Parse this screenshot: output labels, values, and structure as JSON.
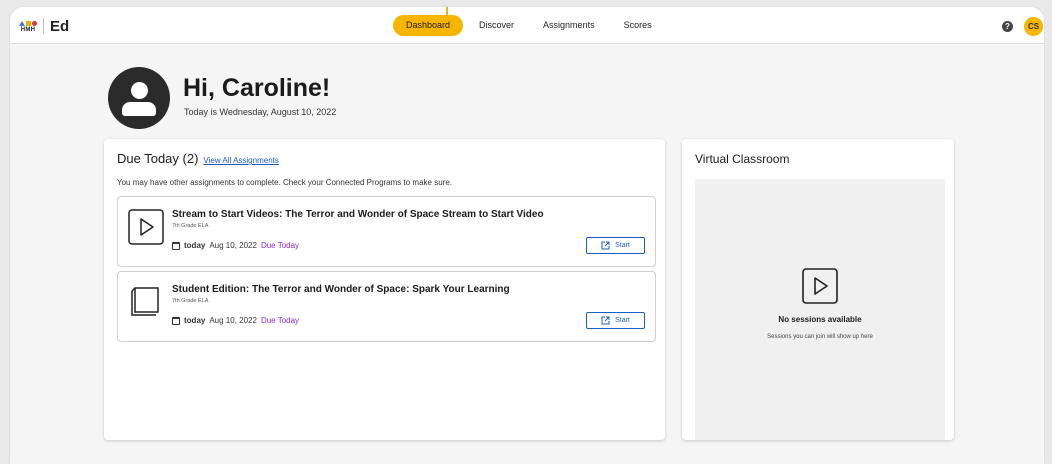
{
  "app": {
    "brand_text": "HMH",
    "brand_name": "Ed",
    "help_glyph": "?",
    "user_initials": "CS",
    "accent_color": "#f7b500",
    "link_color": "#1a5ec9",
    "due_color": "#8a2be2"
  },
  "nav": {
    "tabs": [
      {
        "label": "Dashboard",
        "active": true
      },
      {
        "label": "Discover",
        "active": false
      },
      {
        "label": "Assignments",
        "active": false
      },
      {
        "label": "Scores",
        "active": false
      }
    ]
  },
  "greeting": {
    "title": "Hi, Caroline!",
    "subtitle": "Today is Wednesday, August 10, 2022"
  },
  "due_today": {
    "title": "Due Today (2)",
    "view_all_link": "View All Assignments",
    "note": "You may have other assignments to complete. Check your Connected Programs to make sure.",
    "assignments": [
      {
        "icon": "video-play-icon",
        "title": "Stream to Start Videos: The Terror and Wonder of Space Stream to Start Video",
        "grade": "7th Grade ELA",
        "today_label": "today",
        "date": "Aug 10, 2022",
        "due_label": "Due Today",
        "start_label": "Start"
      },
      {
        "icon": "book-icon",
        "title": "Student Edition: The Terror and Wonder of Space: Spark Your Learning",
        "grade": "7th Grade ELA",
        "today_label": "today",
        "date": "Aug 10, 2022",
        "due_label": "Due Today",
        "start_label": "Start"
      }
    ]
  },
  "virtual_classroom": {
    "title": "Virtual Classroom",
    "empty_title": "No sessions available",
    "empty_hint": "Sessions you can join will show up here"
  }
}
